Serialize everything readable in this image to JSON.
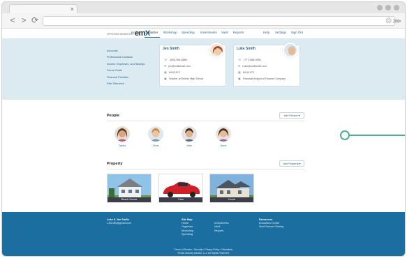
{
  "browser": {
    "tab_close": "×",
    "back": "<",
    "forward": ">",
    "reload": "⟳"
  },
  "header": {
    "logo_small": "OPTIONS MONITOR",
    "logo_main_1": "em",
    "logo_main_2": "X",
    "menu": [
      "Home",
      "Organizer",
      "Workshop",
      "Spending",
      "Investments",
      "Vault",
      "Reports",
      "Help",
      "Settings",
      "Sign Out"
    ],
    "active": "Organizer"
  },
  "organizer": {
    "side_items": [
      "Accounts",
      "Professional Contacts",
      "Income, Expenses, and Savings",
      "Future Goals",
      "Financial Priorities",
      "Risk Tolerance"
    ],
    "cards": [
      {
        "name": "Jen Smith",
        "phone": "(555) 555-8888",
        "email": "jen@smithmail.com",
        "dob": "8/15/1972",
        "job": "Teacher at Rainier High School"
      },
      {
        "name": "Luke Smith",
        "phone": "(777) 888-5555",
        "email": "Luke@smithmail.com",
        "dob": "8/13/1970",
        "job": "Financial Analyst at Finance Company"
      }
    ]
  },
  "people": {
    "title": "People",
    "add_label": "Add Person ▾",
    "list": [
      "Taylor",
      "Chris",
      "John",
      "Anne"
    ]
  },
  "property": {
    "title": "Property",
    "add_label": "Add Property ▾",
    "list": [
      "Beach House",
      "Cars",
      "Home"
    ]
  },
  "footer": {
    "col1": [
      "Luke & Jen Smith",
      "LJSmith@gmail.com"
    ],
    "col2_head": "Site Map",
    "col2": [
      "Home",
      "Organizer",
      "Workshop",
      "Spending"
    ],
    "col3": [
      "Investments",
      "Vault",
      "Reports"
    ],
    "col4_head": "Resources",
    "col4": [
      "Education Center",
      "Start Screen Sharing"
    ],
    "legal": "Terms of Service  •  Security  •  Privacy Policy  •  Disclaimer",
    "copyright": "©2016 eMoney Advisor, LLC  All Rights Reserved."
  },
  "colors": {
    "accent": "#1a6fa0",
    "band": "#dcebf2",
    "slider": "#48b28a"
  }
}
